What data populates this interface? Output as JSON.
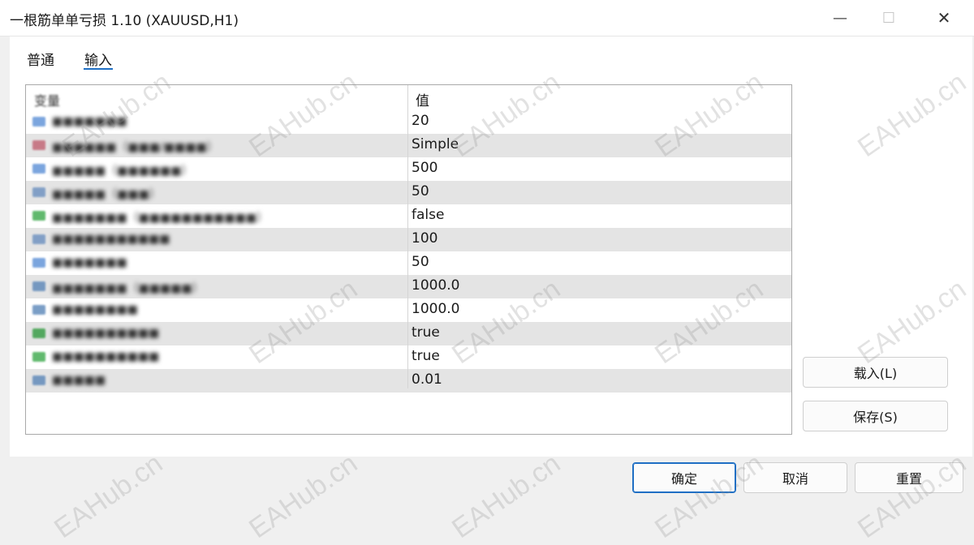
{
  "window": {
    "title": "一根筋单单亏损 1.10 (XAUUSD,H1)",
    "minimize_glyph": "—",
    "maximize_glyph": "☐",
    "close_glyph": "✕"
  },
  "tabs": [
    {
      "label": "普通",
      "selected": false
    },
    {
      "label": "输入",
      "selected": true
    }
  ],
  "table": {
    "header_variable": "变量",
    "header_value": "值",
    "rows": [
      {
        "icon": "integer-icon",
        "icon_color": "#5b8fd6",
        "value": "20"
      },
      {
        "icon": "enum-icon",
        "icon_color": "#c06070",
        "value": "Simple"
      },
      {
        "icon": "integer-icon",
        "icon_color": "#5b8fd6",
        "value": "500"
      },
      {
        "icon": "integer-icon",
        "icon_color": "#6a8fbf",
        "value": "50"
      },
      {
        "icon": "boolean-icon",
        "icon_color": "#3aa84a",
        "value": "false"
      },
      {
        "icon": "integer-icon",
        "icon_color": "#6a8fbf",
        "value": "100"
      },
      {
        "icon": "integer-icon",
        "icon_color": "#5b8fd6",
        "value": "50"
      },
      {
        "icon": "double-icon",
        "icon_color": "#5a86b8",
        "value": "1000.0"
      },
      {
        "icon": "double-icon",
        "icon_color": "#5a86b8",
        "value": "1000.0"
      },
      {
        "icon": "boolean-icon",
        "icon_color": "#2f9a3e",
        "value": "true"
      },
      {
        "icon": "boolean-icon",
        "icon_color": "#3aa84a",
        "value": "true"
      },
      {
        "icon": "double-icon",
        "icon_color": "#5a86b8",
        "value": "0.01"
      }
    ]
  },
  "side_buttons": {
    "load": "载入(L)",
    "save": "保存(S)"
  },
  "footer_buttons": {
    "ok": "确定",
    "cancel": "取消",
    "reset": "重置"
  },
  "watermark_text": "EAHub.cn",
  "colors": {
    "accent": "#1f6fc4",
    "alt_row": "#e4e4e4"
  }
}
